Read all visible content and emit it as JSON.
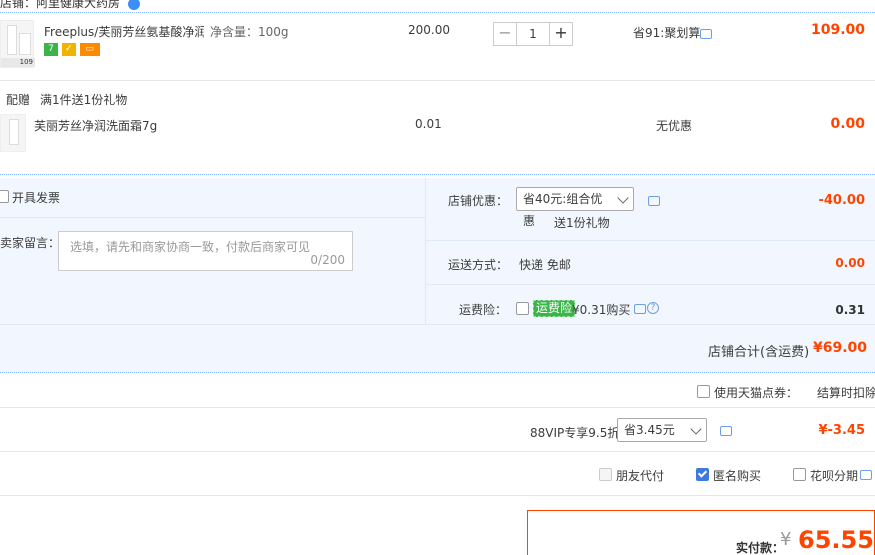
{
  "shop": {
    "name": "店铺：阿里健康大药房"
  },
  "item": {
    "title": "Freeplus/芙丽芳丝氨基酸净润...",
    "spec": "净含量：100g",
    "price": "200.00",
    "quantity": "1",
    "saving": "省91:聚划算",
    "subtotal": "109.00",
    "thumb_label": "109"
  },
  "gift": {
    "tag": "配赠",
    "desc": "满1件送1份礼物",
    "title": "芙丽芳丝净润洗面霜7g",
    "price": "0.01",
    "discount": "无优惠",
    "subtotal": "0.00"
  },
  "order": {
    "invoice_label": "开具发票",
    "message_label": "给卖家留言：",
    "message_placeholder": "选填，请先和商家协商一致，付款后商家可见",
    "message_count": "0/200",
    "shop_discount_label": "店铺优惠：",
    "shop_discount_value": "省40元:组合优惠",
    "shop_discount_sub": "送1份礼物",
    "shop_discount_amount": "-40.00",
    "shipping_label": "运送方式：",
    "shipping_value": "快递 免邮",
    "shipping_amount": "0.00",
    "insurance_label": "运费险：",
    "insurance_tag": "运费险",
    "insurance_price": "¥0.31购买",
    "insurance_amount": "0.31",
    "shop_total_label": "店铺合计(含运费)",
    "shop_total_value": "¥69.00"
  },
  "extras": {
    "tmall_points_label": "使用天猫点券：",
    "tmall_points_note": "结算时扣除",
    "vip_label": "88VIP专享9.5折",
    "vip_select": "省3.45元",
    "vip_amount": "¥-3.45",
    "friend_pay": "朋友代付",
    "anonymous": "匿名购买",
    "huabei": "花呗分期"
  },
  "payment": {
    "label": "实付款：",
    "currency": "¥",
    "amount": "65.55"
  },
  "colors": {
    "accent": "#ff4400",
    "blue_bg": "#f2f7ff",
    "checkbox": "#3d7ae0"
  }
}
